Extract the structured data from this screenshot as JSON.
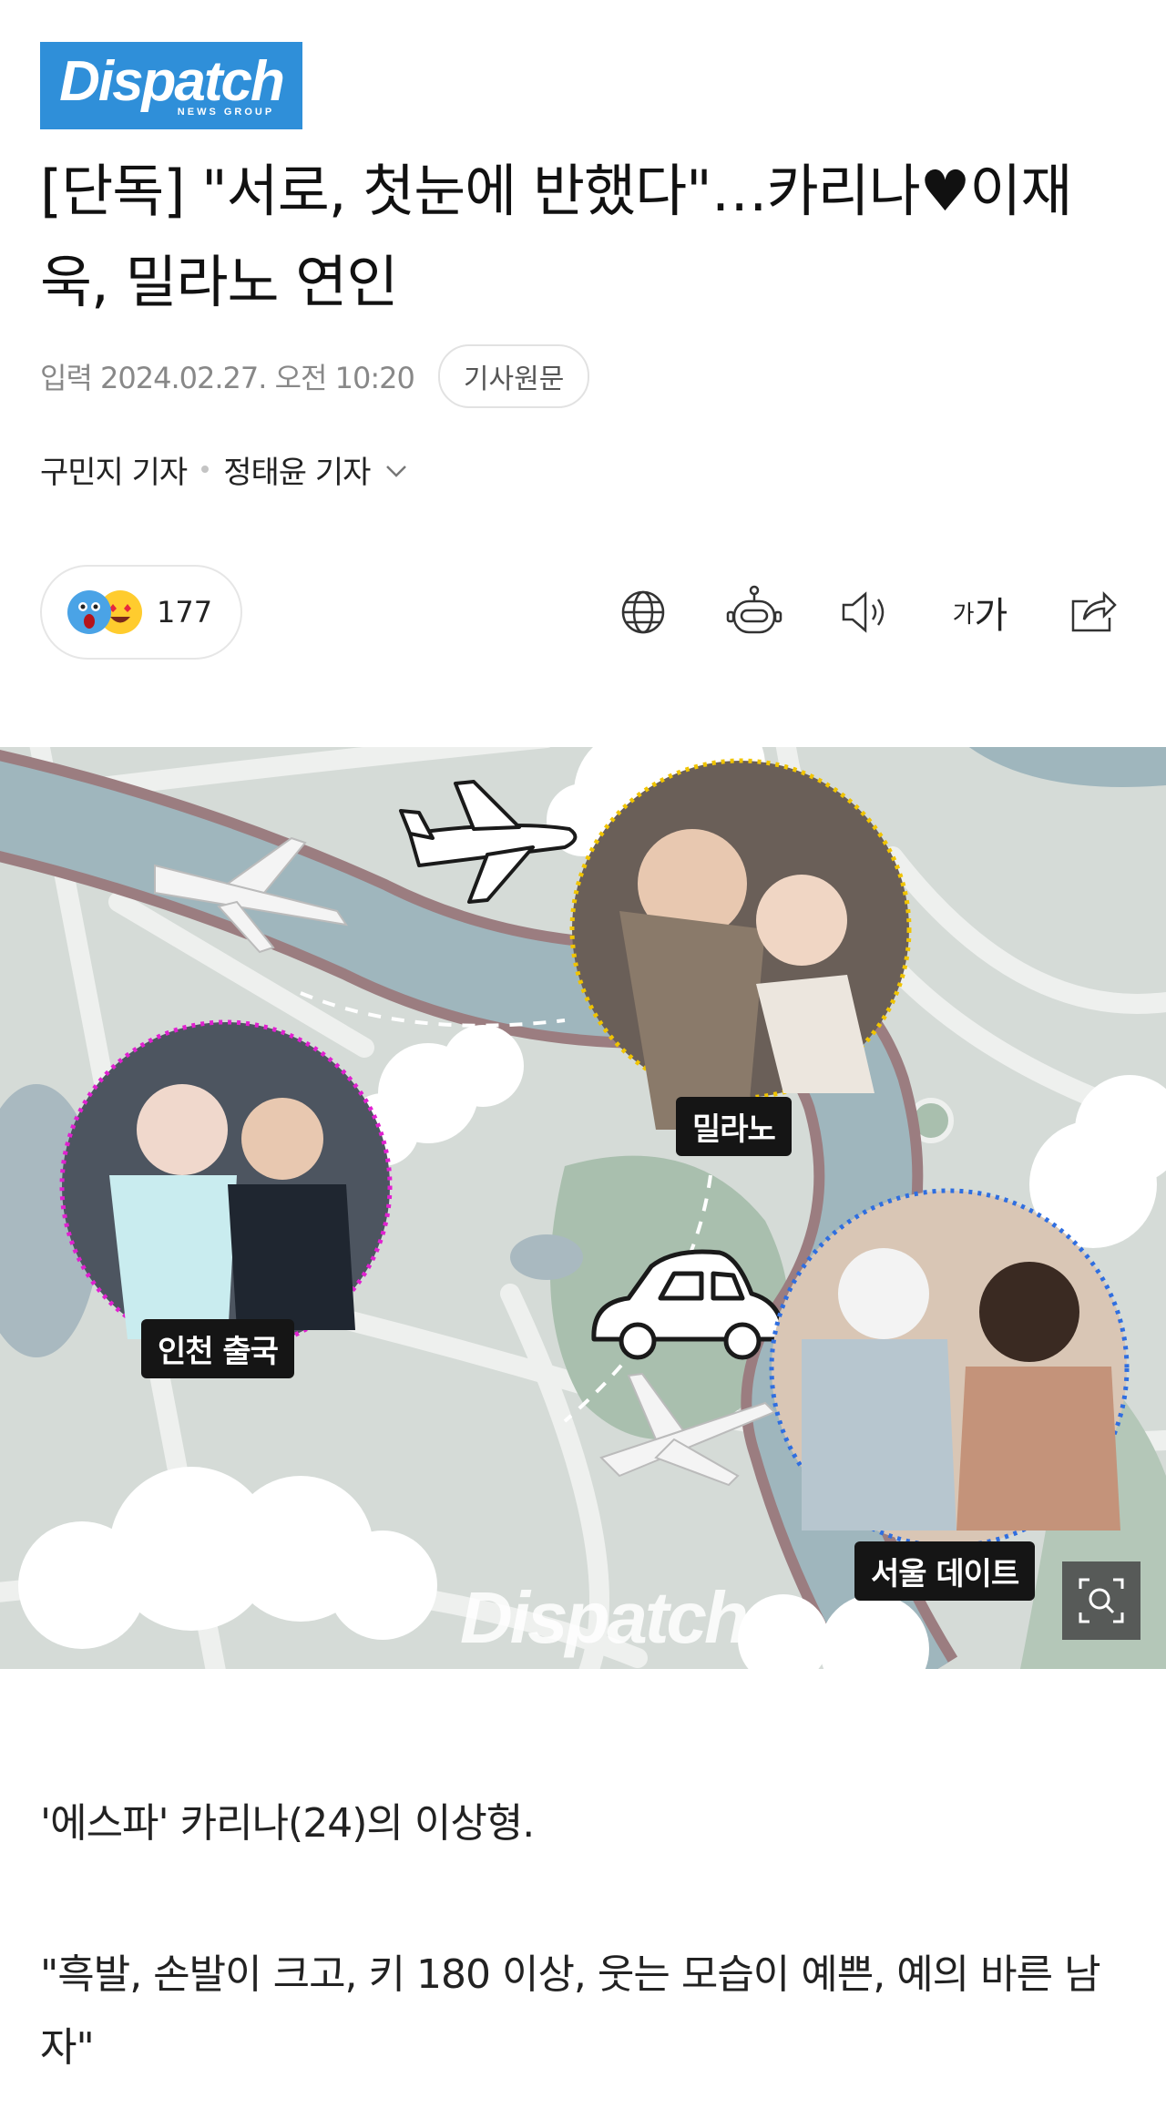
{
  "logo": {
    "main": "Dispatch",
    "sub": "NEWS GROUP"
  },
  "article": {
    "title": "[단독] \"서로, 첫눈에 반했다\"…카리나♥이재욱, 밀라노 연인",
    "date": "입력 2024.02.27. 오전 10:20",
    "original_label": "기사원문",
    "authors": [
      "구민지 기자",
      "정태윤 기자"
    ]
  },
  "reactions": {
    "count": "177"
  },
  "toolbar": {
    "icons": [
      "globe-icon",
      "robot-icon",
      "speaker-icon",
      "font-size-icon",
      "share-icon"
    ],
    "font_size_label_small": "가",
    "font_size_label_large": "가"
  },
  "hero": {
    "labels": {
      "milan": "밀라노",
      "incheon": "인천 출국",
      "seoul": "서울 데이트"
    },
    "watermark": "Dispatch"
  },
  "body": {
    "p1": "'에스파' 카리나(24)의 이상형.",
    "p2": "\"흑발, 손발이 크고, 키 180 이상, 웃는 모습이 예쁜, 예의 바른 남자\""
  },
  "colors": {
    "logo_bg": "#2f8fd9",
    "river": "#9fb6bd",
    "park": "#a9bfae"
  }
}
